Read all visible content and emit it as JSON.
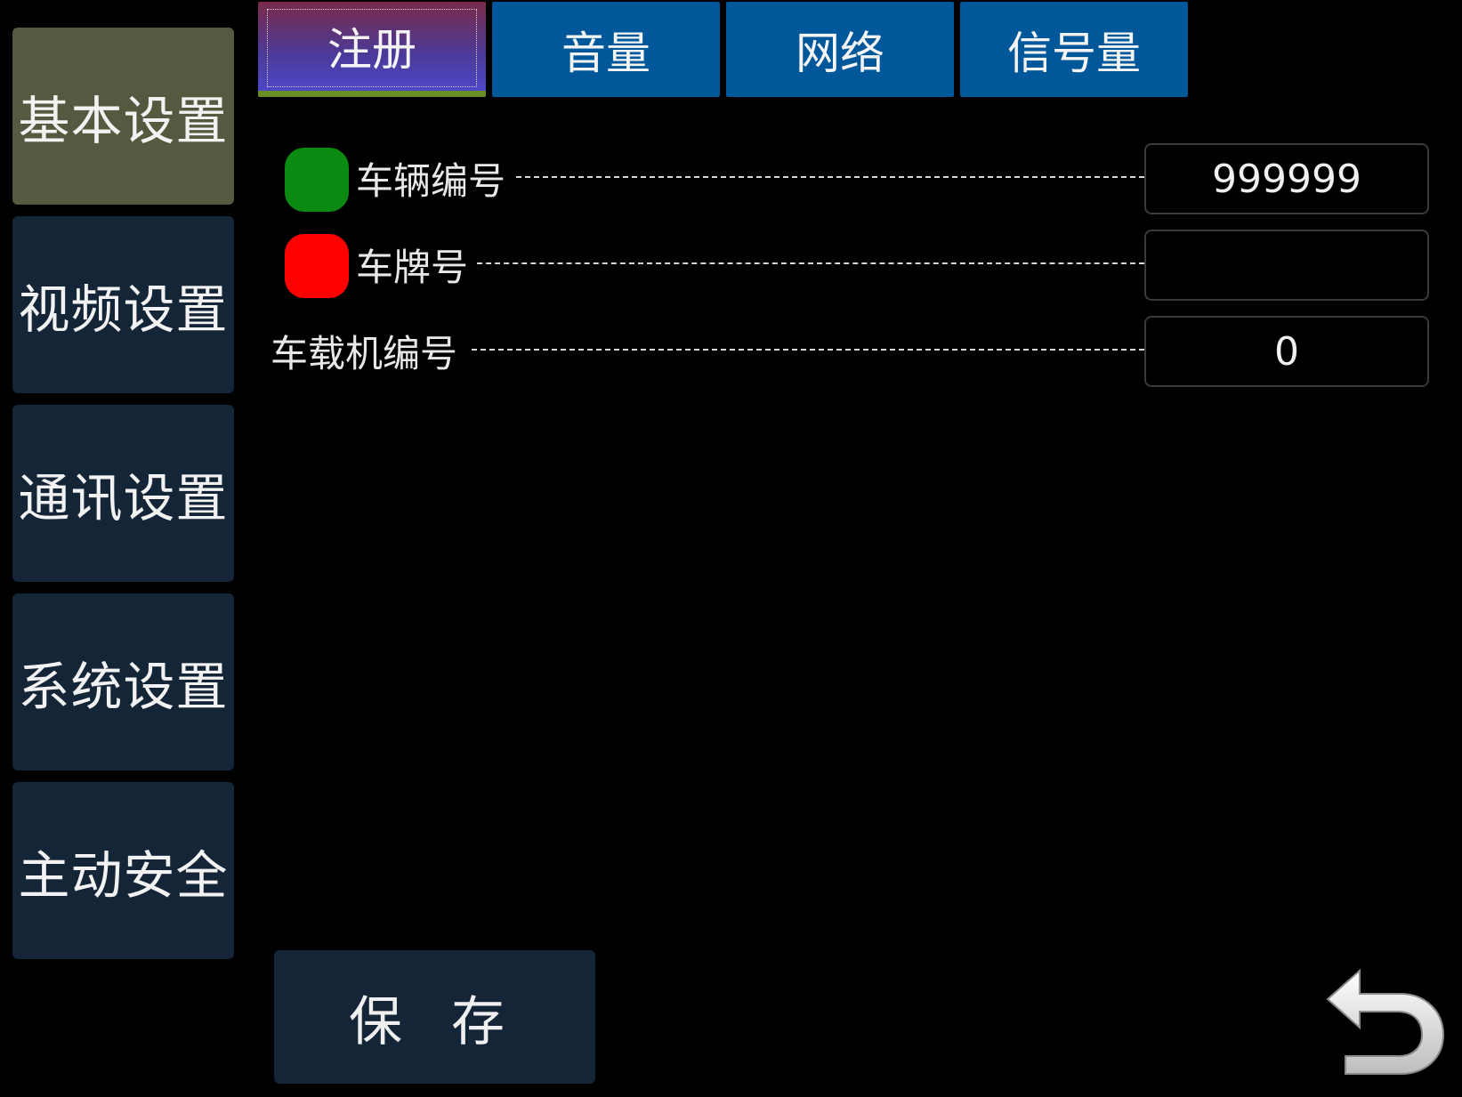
{
  "sidebar": {
    "items": [
      {
        "label": "基本设置",
        "active": true
      },
      {
        "label": "视频设置",
        "active": false
      },
      {
        "label": "通讯设置",
        "active": false
      },
      {
        "label": "系统设置",
        "active": false
      },
      {
        "label": "主动安全",
        "active": false
      }
    ]
  },
  "tabs": [
    {
      "label": "注册",
      "active": true
    },
    {
      "label": "音量",
      "active": false
    },
    {
      "label": "网络",
      "active": false
    },
    {
      "label": "信号量",
      "active": false
    }
  ],
  "form": {
    "vehicle_number": {
      "label": "车辆编号",
      "value": "999999",
      "status_color": "#0a8a10"
    },
    "plate_number": {
      "label": "车牌号",
      "value": "",
      "status_color": "#ff0000"
    },
    "device_number": {
      "label": "车载机编号",
      "value": "0"
    }
  },
  "save_label": "保 存",
  "colors": {
    "background": "#000000",
    "sidebar_button": "#152538",
    "sidebar_active": "#56593f",
    "tab": "#00589a",
    "tab_active_underline": "#6b8e23"
  },
  "icons": {
    "back": "back-arrow-icon"
  }
}
